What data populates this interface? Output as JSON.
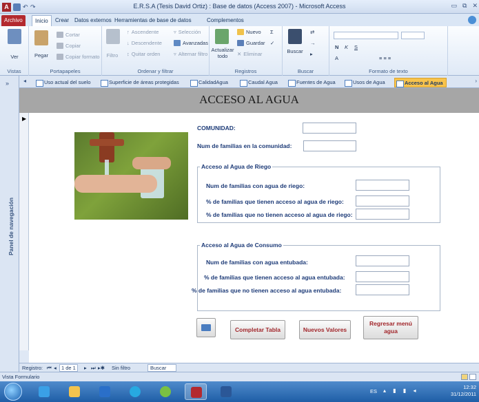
{
  "window": {
    "title": "E.R.S.A (Tesis David Ortiz) : Base de datos (Access 2007) - Microsoft Access",
    "app_icon": "A"
  },
  "ribbon_tabs": [
    "Archivo",
    "Inicio",
    "Crear",
    "Datos externos",
    "Herramientas de base de datos",
    "Complementos"
  ],
  "ribbon": {
    "vistas": {
      "ver": "Ver",
      "label": "Vistas"
    },
    "portapapeles": {
      "pegar": "Pegar",
      "cortar": "Cortar",
      "copiar": "Copiar",
      "copiar_formato": "Copiar formato",
      "label": "Portapapeles"
    },
    "ordenar": {
      "filtro": "Filtro",
      "ascendente": "Ascendente",
      "descendente": "Descendente",
      "quitar_orden": "Quitar orden",
      "seleccion": "Selección",
      "avanzadas": "Avanzadas",
      "alternar_filtro": "Alternar filtro",
      "label": "Ordenar y filtrar"
    },
    "registros": {
      "actualizar": "Actualizar",
      "todo": "todo",
      "nuevo": "Nuevo",
      "guardar": "Guardar",
      "eliminar": "Eliminar",
      "label": "Registros"
    },
    "buscar": {
      "buscar": "Buscar",
      "label": "Buscar"
    },
    "formato": {
      "bold": "N",
      "italic": "K",
      "underline": "S",
      "label": "Formato de texto"
    }
  },
  "nav_pane": {
    "label": "Panel de navegación",
    "toggle": "»"
  },
  "doc_tabs": [
    {
      "label": "Uso actual del suelo",
      "active": false
    },
    {
      "label": "Superficie de áreas protegidas",
      "active": false
    },
    {
      "label": "CalidadAgua",
      "active": false
    },
    {
      "label": "Caudal Agua",
      "active": false
    },
    {
      "label": "Fuentes de Agua",
      "active": false
    },
    {
      "label": "Usos de Agua",
      "active": false
    },
    {
      "label": "Acceso al Agua",
      "active": true
    }
  ],
  "form": {
    "title": "ACCESO AL AGUA",
    "comunidad_label": "COMUNIDAD:",
    "num_familias_label": "Num de familias en la comunidad:",
    "riego": {
      "legend": "Acceso al Agua de Riego",
      "con_agua_label": "Num de familias con agua de riego:",
      "pct_con_label": "% de familias que tienen acceso al agua de riego:",
      "pct_sin_label": "% de familias que no tienen acceso al agua de riego:"
    },
    "consumo": {
      "legend": "Acceso al Agua de Consumo",
      "con_agua_label": "Num de familias con agua entubada:",
      "pct_con_label": "% de familias que tienen acceso al agua entubada:",
      "pct_sin_label": "% de familias que no tienen acceso al agua entubada:"
    },
    "buttons": {
      "completar": "Completar Tabla",
      "nuevos": "Nuevos Valores",
      "regresar": "Regresar menú agua"
    },
    "values": {
      "comunidad": "",
      "num_familias": "",
      "riego_con": "",
      "riego_pct_con": "",
      "riego_pct_sin": "",
      "consumo_con": "",
      "consumo_pct_con": "",
      "consumo_pct_sin": ""
    }
  },
  "record_nav": {
    "label": "Registro:",
    "current": "1 de 1",
    "filter": "Sin filtro",
    "search": "Buscar"
  },
  "status": {
    "text": "Vista Formulario"
  },
  "taskbar": {
    "lang": "ES",
    "time": "12:32",
    "date": "31/12/2011"
  }
}
